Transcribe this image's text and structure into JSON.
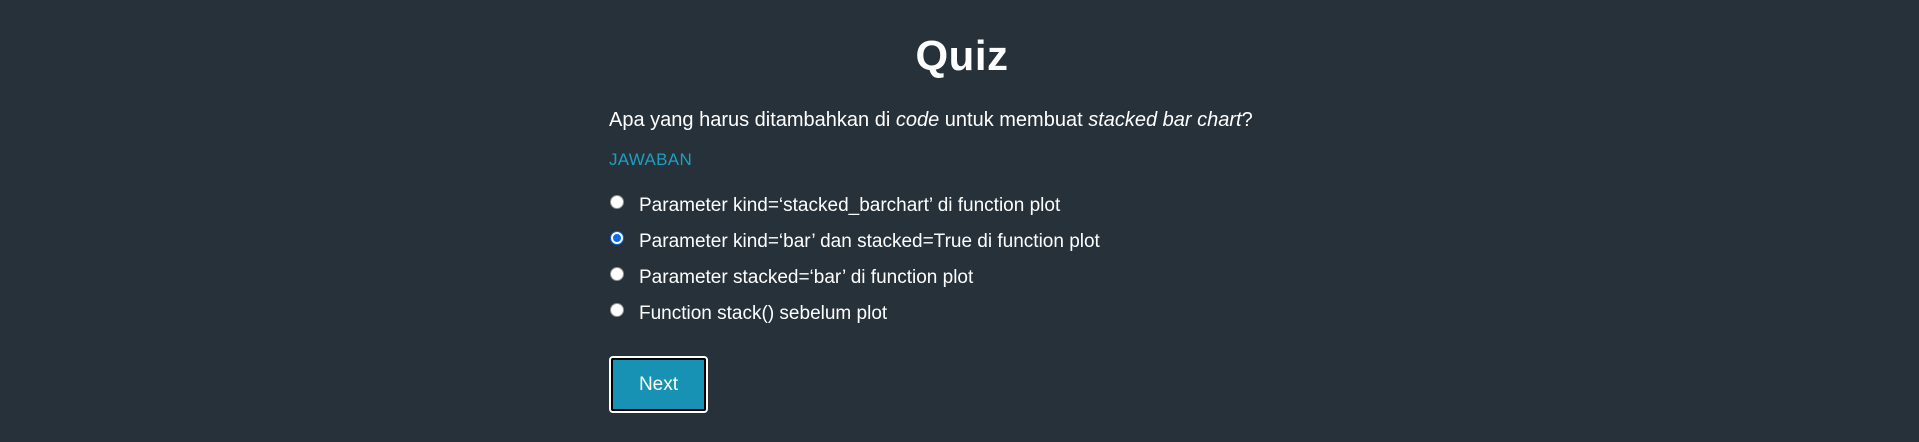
{
  "page": {
    "title": "Quiz"
  },
  "question": {
    "part1": "Apa yang harus ditambahkan di ",
    "part2": "code",
    "part3": " untuk membuat ",
    "part4": "stacked bar chart",
    "part5": "?"
  },
  "answer_label": "JAWABAN",
  "options": [
    {
      "label": "Parameter kind=‘stacked_barchart’ di function plot",
      "selected": false
    },
    {
      "label": "Parameter kind=‘bar’ dan stacked=True di function plot",
      "selected": true
    },
    {
      "label": "Parameter stacked=‘bar’ di function plot",
      "selected": false
    },
    {
      "label": "Function stack() sebelum plot",
      "selected": false
    }
  ],
  "next_button": {
    "label": "Next"
  },
  "colors": {
    "background": "#263139",
    "accent": "#1c9fc2",
    "button": "#1792b4",
    "radio_selected": "#0b6ae8"
  }
}
